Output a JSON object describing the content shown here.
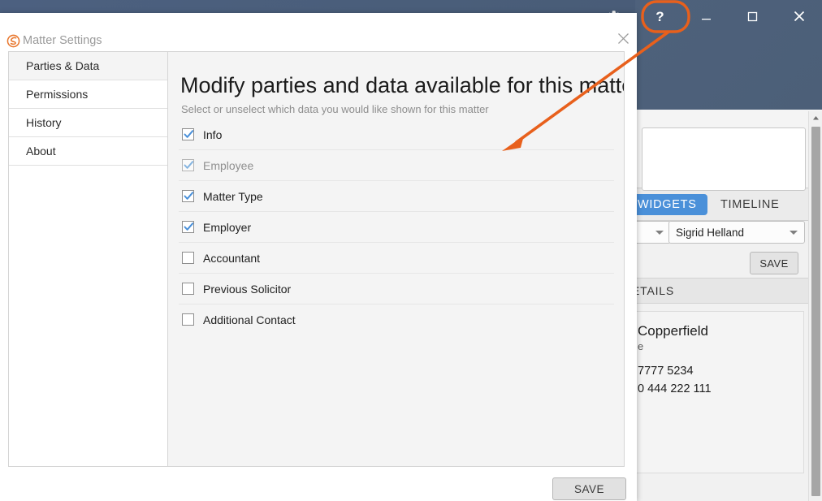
{
  "background_app": {
    "window_controls": [
      {
        "name": "settings-gear",
        "icon": "gear-icon",
        "label": "Settings"
      },
      {
        "name": "help",
        "icon": "question-mark-icon",
        "label": "?"
      },
      {
        "name": "minimize",
        "icon": "minimize-icon",
        "label": "–"
      },
      {
        "name": "maximize",
        "icon": "maximize-icon",
        "label": "☐"
      },
      {
        "name": "close",
        "icon": "close-icon",
        "label": "✕"
      }
    ],
    "tabs": [
      {
        "label": "WIDGETS",
        "active": true
      },
      {
        "label": "TIMELINE",
        "active": false
      }
    ],
    "person_select_value": "Sigrid Helland",
    "save_label": "SAVE",
    "section_header": "ETAILS",
    "detail_card": {
      "name": "Copperfield",
      "subtitle": "e",
      "phone_1": "7777 5234",
      "phone_2": "0 444 222 111"
    }
  },
  "dialog": {
    "title": "Matter Settings",
    "logo_icon": "app-logo-icon",
    "close_icon": "close-icon",
    "sidebar": {
      "items": [
        {
          "label": "Parties & Data",
          "active": true
        },
        {
          "label": "Permissions",
          "active": false
        },
        {
          "label": "History",
          "active": false
        },
        {
          "label": "About",
          "active": false
        }
      ]
    },
    "content": {
      "heading": "Modify parties and data available for this matter",
      "subheading": "Select or unselect which data you would like shown for this matter",
      "checkboxes": [
        {
          "label": "Info",
          "checked": true,
          "disabled": false
        },
        {
          "label": "Employee",
          "checked": true,
          "disabled": true
        },
        {
          "label": "Matter Type",
          "checked": true,
          "disabled": false
        },
        {
          "label": "Employer",
          "checked": true,
          "disabled": false
        },
        {
          "label": "Accountant",
          "checked": false,
          "disabled": false
        },
        {
          "label": "Previous Solicitor",
          "checked": false,
          "disabled": false
        },
        {
          "label": "Additional Contact",
          "checked": false,
          "disabled": false
        }
      ]
    },
    "save_label": "SAVE"
  },
  "annotation": {
    "type": "arrow-with-highlight",
    "color": "#e8601c",
    "target_icon": "gear-icon",
    "highlight_shape": "rounded-rectangle"
  },
  "colors": {
    "titlebar": "#4a5e7a",
    "accent_blue": "#4a90d9",
    "annotation_orange": "#e8601c",
    "logo_orange": "#e8762c",
    "panel_gray": "#f4f4f4"
  }
}
